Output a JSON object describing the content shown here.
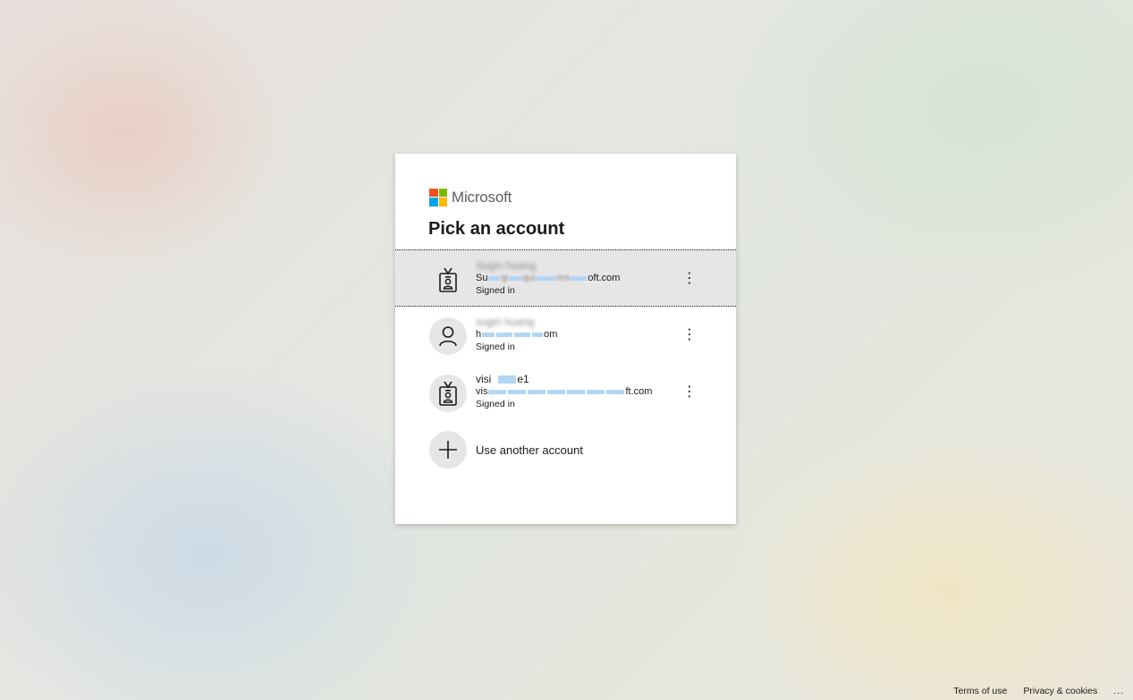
{
  "brand": {
    "name": "Microsoft",
    "logo_colors": [
      "#f25022",
      "#7fba00",
      "#00a4ef",
      "#ffb900"
    ]
  },
  "title": "Pick an account",
  "accounts": [
    {
      "name": "Sugin huang",
      "email_prefix": "Su",
      "email_suffix": "oft.com",
      "status": "Signed in",
      "icon": "badge-icon"
    },
    {
      "name": "sugin huang",
      "email_prefix": "h",
      "email_suffix": "om",
      "status": "Signed in",
      "icon": "person-icon"
    },
    {
      "name_prefix": "visi",
      "name_suffix": "e1",
      "email_prefix": "vis",
      "email_suffix": "ft.com",
      "status": "Signed in",
      "icon": "badge-icon"
    }
  ],
  "more_options_glyph": "⋮",
  "use_another": {
    "label": "Use another account",
    "icon": "plus-icon"
  },
  "footer": {
    "terms": "Terms of use",
    "privacy": "Privacy & cookies",
    "more": "..."
  }
}
